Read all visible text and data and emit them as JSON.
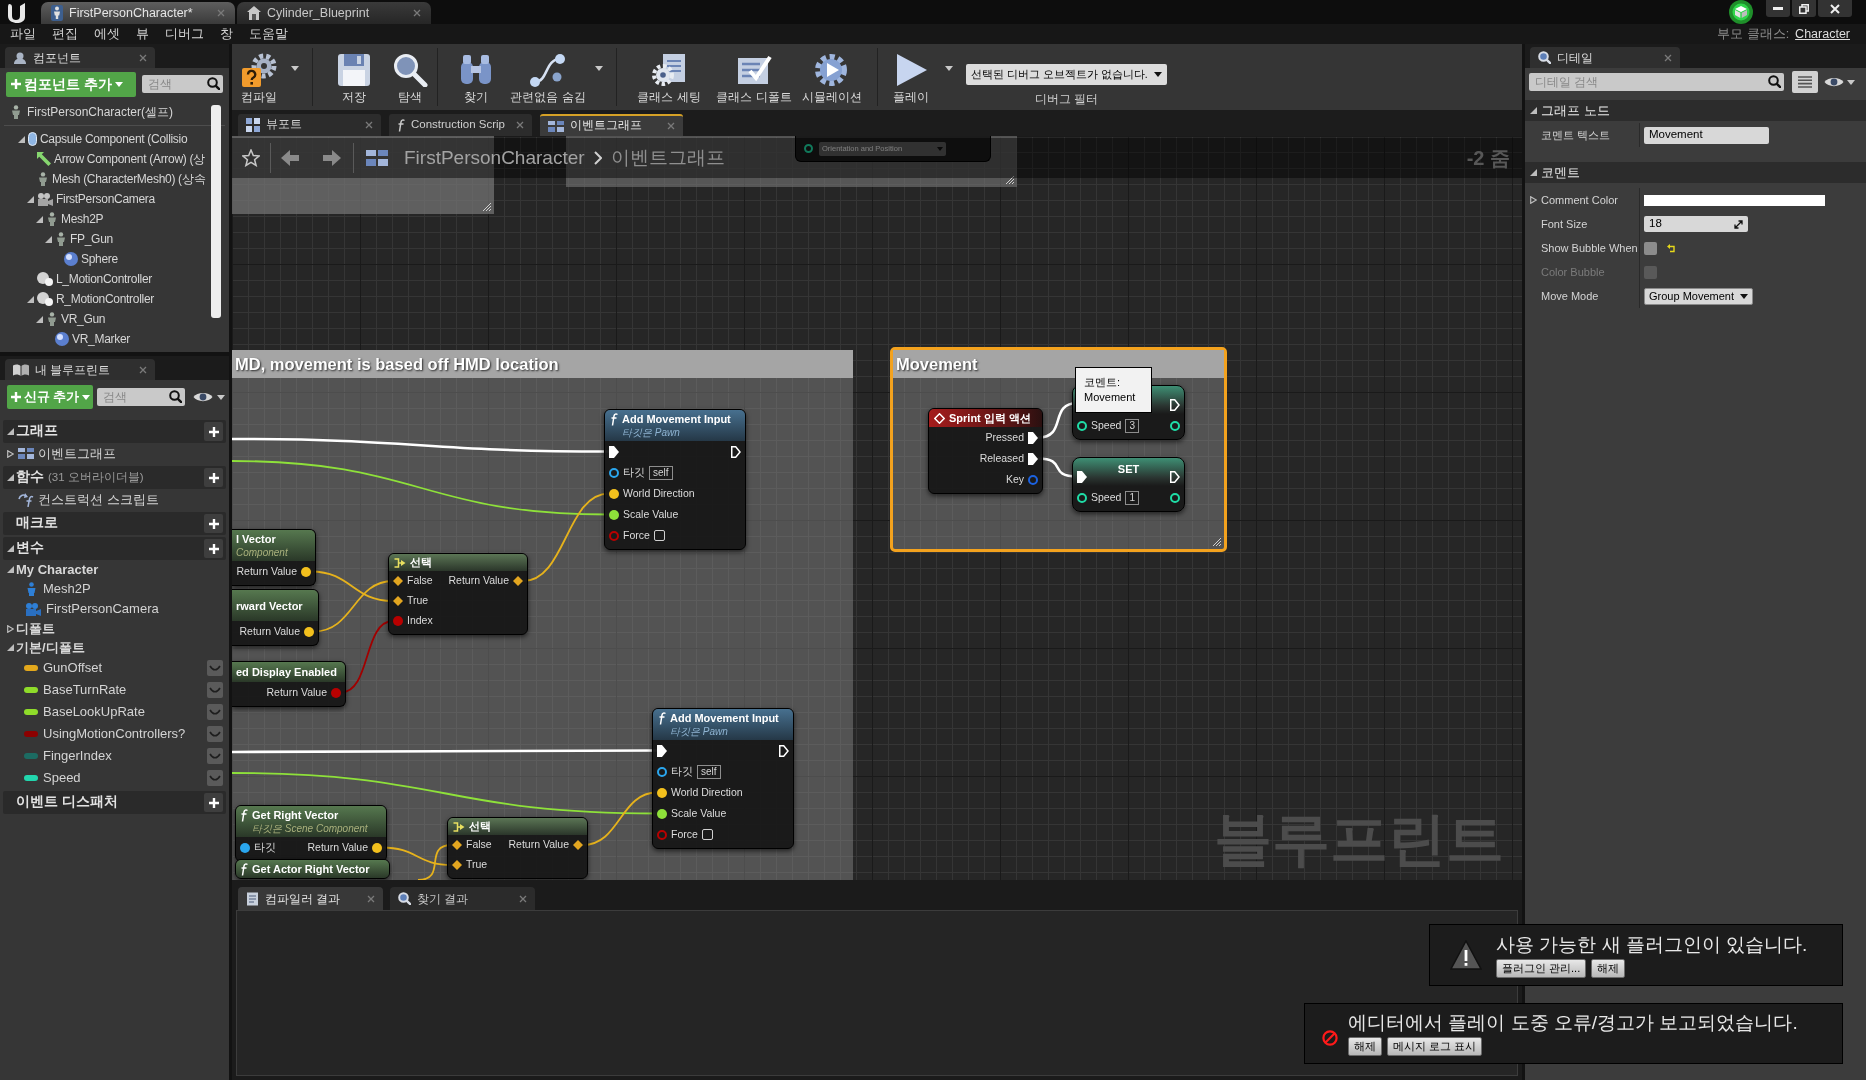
{
  "title_bar": {
    "tabs": [
      {
        "label": "FirstPersonCharacter*",
        "kind": "blueprint",
        "selected": true
      },
      {
        "label": "Cylinder_Blueprint",
        "kind": "house",
        "selected": false
      }
    ]
  },
  "menu_bar": {
    "items": [
      "파일",
      "편집",
      "에셋",
      "뷰",
      "디버그",
      "창",
      "도움말"
    ],
    "parent_class_label": "부모 클래스:",
    "parent_class": "Character"
  },
  "components_panel": {
    "tab": "컴포넌트",
    "add_button": "컴포넌트 추가",
    "search": {
      "placeholder": "검색"
    },
    "root": {
      "label": "FirstPersonCharacter(셀프)",
      "kind": "figure"
    },
    "tree": [
      {
        "label": "Capsule Component (Collisio",
        "kind": "capsule",
        "expanded": true,
        "children": [
          {
            "label": "Arrow Component (Arrow) (상",
            "kind": "arrow"
          },
          {
            "label": "Mesh (CharacterMesh0) (상속",
            "kind": "figure"
          },
          {
            "label": "FirstPersonCamera",
            "kind": "camera",
            "expanded": true,
            "children": [
              {
                "label": "Mesh2P",
                "kind": "figure",
                "expanded": true,
                "children": [
                  {
                    "label": "FP_Gun",
                    "kind": "figure",
                    "expanded": true,
                    "children": [
                      {
                        "label": "Sphere",
                        "kind": "sphere"
                      }
                    ]
                  }
                ]
              }
            ]
          },
          {
            "label": "L_MotionController",
            "kind": "controller"
          },
          {
            "label": "R_MotionController",
            "kind": "controller",
            "expanded": true,
            "children": [
              {
                "label": "VR_Gun",
                "kind": "figure",
                "expanded": true,
                "children": [
                  {
                    "label": "VR_Marker",
                    "kind": "sphere"
                  }
                ]
              }
            ]
          }
        ]
      }
    ]
  },
  "my_blueprint_panel": {
    "tab": "내 블루프린트",
    "add_button": "신규 추가",
    "search": {
      "placeholder": "검색"
    },
    "sections": [
      {
        "title": "그래프",
        "expanded": true,
        "items": [
          {
            "label": "이벤트그래프",
            "kind": "graph",
            "expanded": false
          }
        ]
      },
      {
        "title": "함수",
        "note": "(31 오버라이더블)",
        "expanded": true,
        "items": [
          {
            "label": "컨스트럭션 스크립트",
            "kind": "function"
          }
        ]
      },
      {
        "title": "매크로"
      },
      {
        "title": "변수",
        "expanded": true,
        "categories": [
          {
            "title": "My Character",
            "expanded": true,
            "items": [
              {
                "label": "Mesh2P",
                "kind": "mesh"
              },
              {
                "label": "FirstPersonCamera",
                "kind": "camera"
              }
            ]
          },
          {
            "title": "디폴트",
            "expanded": false
          },
          {
            "title": "기본/디폴트",
            "expanded": true,
            "items": [
              {
                "label": "GunOffset",
                "kind": "variable",
                "color": "#e3a81c",
                "exposed": false
              },
              {
                "label": "BaseTurnRate",
                "kind": "variable",
                "color": "#8fdc2a",
                "exposed": false
              },
              {
                "label": "BaseLookUpRate",
                "kind": "variable",
                "color": "#8fdc2a",
                "exposed": false
              },
              {
                "label": "UsingMotionControllers?",
                "kind": "variable",
                "color": "#8c0000",
                "exposed": false
              },
              {
                "label": "FingerIndex",
                "kind": "variable",
                "color": "#1c6b62",
                "exposed": false
              },
              {
                "label": "Speed",
                "kind": "variable",
                "color": "#22d6ad",
                "exposed": false
              }
            ]
          }
        ]
      },
      {
        "title": "이벤트 디스패처"
      }
    ]
  },
  "toolbar": {
    "buttons": [
      {
        "label": "컴파일",
        "kind": "compile",
        "dropdown": true
      },
      {
        "label": "저장",
        "kind": "save",
        "dropdown": false
      },
      {
        "label": "탐색",
        "kind": "browse",
        "dropdown": false
      },
      {
        "label": "찾기",
        "kind": "find",
        "dropdown": false
      },
      {
        "label": "관련없음 숨김",
        "kind": "hide_unrelated",
        "dropdown": true
      },
      {
        "label": "클래스 세팅",
        "kind": "class_settings",
        "dropdown": false
      },
      {
        "label": "클래스 디폴트",
        "kind": "class_defaults",
        "dropdown": false
      },
      {
        "label": "시뮬레이션",
        "kind": "simulate",
        "dropdown": false
      },
      {
        "label": "플레이",
        "kind": "play",
        "dropdown": true
      }
    ],
    "debug_filter": {
      "value": "선택된 디버그 오브젝트가 없습니다.",
      "label": "디버그 필터"
    }
  },
  "graph_tabs": [
    {
      "label": "뷰포트",
      "kind": "viewport",
      "selected": false
    },
    {
      "label": "Construction Scrip",
      "kind": "function",
      "selected": false
    },
    {
      "label": "이벤트그래프",
      "kind": "graph",
      "selected": true
    }
  ],
  "breadcrumb": {
    "path": [
      "FirstPersonCharacter",
      "이벤트그래프"
    ],
    "zoom": "-2 줌"
  },
  "graph": {
    "comments": [
      {
        "title": "MD, movement is based off HMD location",
        "selected": false
      },
      {
        "title": "Movement",
        "selected": true
      }
    ],
    "top_node": {
      "dropdown": "Orientation and Position"
    },
    "nodes": [
      {
        "kind": "function",
        "title": "Add Movement Input",
        "subtitle": "타깃은 Pawn",
        "rows": [
          {
            "left": {
              "kind": "exec",
              "connected": true
            },
            "right": {
              "kind": "exec",
              "connected": false
            }
          },
          {
            "left": {
              "kind": "object",
              "label": "타깃",
              "value": "self",
              "connected": false
            }
          },
          {
            "left": {
              "kind": "vector",
              "label": "World Direction",
              "connected": true
            }
          },
          {
            "left": {
              "kind": "float",
              "label": "Scale Value",
              "connected": true
            }
          },
          {
            "left": {
              "kind": "bool",
              "label": "Force",
              "connected": false,
              "checked": false
            }
          }
        ]
      },
      {
        "kind": "select",
        "title": "선택",
        "rows": [
          {
            "left": {
              "kind": "option",
              "label": "False",
              "connected": true
            },
            "right": {
              "kind": "option",
              "label": "Return Value",
              "connected": true
            }
          },
          {
            "left": {
              "kind": "option",
              "label": "True",
              "connected": true
            }
          },
          {
            "left": {
              "kind": "bool",
              "label": "Index",
              "connected": true
            }
          }
        ]
      },
      {
        "kind": "pure",
        "cut_off": true,
        "title": "l Vector",
        "subtitle": "Component",
        "rows": [
          {
            "right": {
              "kind": "vector",
              "label": "Return Value",
              "connected": true
            }
          }
        ]
      },
      {
        "kind": "pure",
        "cut_off": true,
        "title": "rward Vector",
        "rows": [
          {
            "right": {
              "kind": "vector",
              "label": "Return Value",
              "connected": true
            }
          }
        ]
      },
      {
        "kind": "pure",
        "cut_off": true,
        "title": "ed Display Enabled",
        "rows": [
          {
            "right": {
              "kind": "bool",
              "label": "Return Value",
              "connected": true
            }
          }
        ]
      },
      {
        "kind": "function",
        "title": "Add Movement Input",
        "subtitle": "타깃은 Pawn",
        "rows": [
          {
            "left": {
              "kind": "exec",
              "connected": true
            },
            "right": {
              "kind": "exec",
              "connected": false
            }
          },
          {
            "left": {
              "kind": "object",
              "label": "타깃",
              "value": "self",
              "connected": false
            }
          },
          {
            "left": {
              "kind": "vector",
              "label": "World Direction",
              "connected": true
            }
          },
          {
            "left": {
              "kind": "float",
              "label": "Scale Value",
              "connected": true
            }
          },
          {
            "left": {
              "kind": "bool",
              "label": "Force",
              "connected": false,
              "checked": false
            }
          }
        ]
      },
      {
        "kind": "pure",
        "cut_off": false,
        "title": "Get Right Vector",
        "subtitle": "타깃은 Scene Component",
        "rows": [
          {
            "left": {
              "kind": "object",
              "label": "타깃",
              "connected": true
            },
            "right": {
              "kind": "vector",
              "label": "Return Value",
              "connected": true
            }
          }
        ]
      },
      {
        "kind": "select",
        "title": "선택",
        "rows": [
          {
            "left": {
              "kind": "option",
              "label": "False",
              "connected": true
            },
            "right": {
              "kind": "option",
              "label": "Return Value",
              "connected": true
            }
          },
          {
            "left": {
              "kind": "option",
              "label": "True",
              "connected": true
            }
          }
        ]
      },
      {
        "kind": "pure",
        "cut_off": false,
        "title": "Get Actor Right Vector"
      },
      {
        "kind": "input_action",
        "title": "Sprint 입력 액션",
        "rows": [
          {
            "right": {
              "kind": "exec",
              "label": "Pressed",
              "connected": true
            }
          },
          {
            "right": {
              "kind": "exec",
              "label": "Released",
              "connected": true
            }
          },
          {
            "right": {
              "kind": "struct",
              "label": "Key",
              "connected": false
            }
          }
        ]
      },
      {
        "kind": "set",
        "rows": [
          {
            "right": {
              "kind": "exec",
              "connected": false
            }
          },
          {
            "left": {
              "kind": "int",
              "label": "Speed",
              "value": "3",
              "connected": false
            },
            "right": {
              "kind": "int",
              "connected": false
            }
          }
        ]
      },
      {
        "kind": "set",
        "title": "SET",
        "rows": [
          {
            "left": {
              "kind": "exec",
              "connected": true
            },
            "right": {
              "kind": "exec",
              "connected": false
            }
          },
          {
            "left": {
              "kind": "int",
              "label": "Speed",
              "value": "1",
              "connected": false
            },
            "right": {
              "kind": "int",
              "connected": false
            }
          }
        ]
      }
    ],
    "tooltip": "코멘트:\nMovement",
    "corner_label": "블루프린트"
  },
  "bottom_panel": {
    "tabs": [
      {
        "label": "컴파일러 결과",
        "kind": "log",
        "selected": true
      },
      {
        "label": "찾기 결과",
        "kind": "find",
        "selected": false
      }
    ]
  },
  "details_panel": {
    "tab": "디테일",
    "search": {
      "placeholder": "디테일 검색"
    },
    "sections": [
      {
        "title": "그래프 노드",
        "expanded": true,
        "rows": [
          {
            "label": "코멘트 텍스트",
            "kind": "text",
            "value": "Movement",
            "disabled": false
          }
        ]
      },
      {
        "title": "코멘트",
        "expanded": true,
        "rows": [
          {
            "label": "Comment Color",
            "kind": "color",
            "color": "#ffffff",
            "disabled": false
          },
          {
            "label": "Font Size",
            "kind": "number",
            "value": "18",
            "disabled": false
          },
          {
            "label": "Show Bubble When",
            "kind": "checkbox",
            "checked": false,
            "modified": true,
            "disabled": false
          },
          {
            "label": "Color Bubble",
            "kind": "checkbox",
            "checked": false,
            "modified": false,
            "disabled": true
          },
          {
            "label": "Move Mode",
            "kind": "dropdown",
            "value": "Group Movement",
            "disabled": false
          }
        ]
      }
    ]
  },
  "notifications": [
    {
      "kind": "warning",
      "message": "사용 가능한 새 플러그인이 있습니다.",
      "buttons": [
        "플러그인 관리...",
        "해제"
      ]
    },
    {
      "kind": "error",
      "message": "에디터에서 플레이 도중 오류/경고가 보고되었습니다.",
      "buttons": [
        "해제",
        "메시지 로그 표시"
      ]
    }
  ]
}
